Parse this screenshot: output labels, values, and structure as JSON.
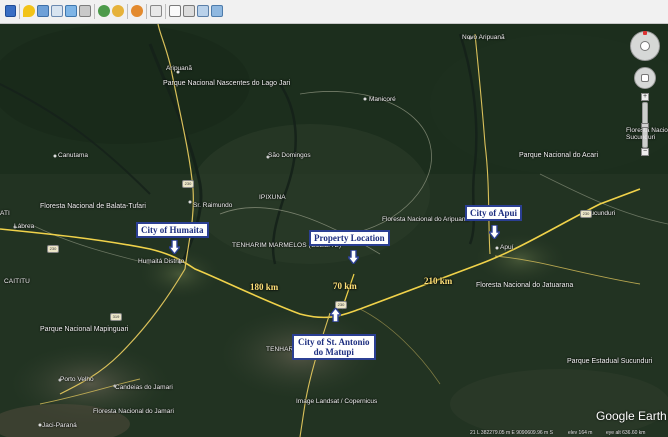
{
  "toolbar": {
    "icons": [
      "sidebar-toggle-icon",
      "placemark-icon",
      "polygon-icon",
      "path-icon",
      "image-overlay-icon",
      "tour-icon",
      "historical-imagery-icon",
      "sunlight-icon",
      "planets-icon",
      "ruler-icon",
      "email-icon",
      "print-icon",
      "save-image-icon",
      "maps-icon",
      "kml-icon"
    ]
  },
  "labels": {
    "novo_aripuana": "Novo Aripuanã",
    "aripuana_river": "Aripuanã",
    "parque_lago_jari": "Parque Nacional Nascentes do Lago Jari",
    "manicore": "Manicoré",
    "sao_domingos": "São Domingos",
    "canutama": "Canutama",
    "parque_acari": "Parque Nacional do Acari",
    "balata_tufari": "Floresta Nacional de Balata-Tufari",
    "sao_raimundo": "Sr. Raimundo",
    "ipixuna": "IPIXUNA",
    "tenharim_marmelos": "TENHARIM MARMELOS (GLEBA B)",
    "floresta_aripuana": "Floresta Nacional do Aripuanã",
    "sucunduri": "Sucunduri",
    "lati": "ATI",
    "labrea": "Lábrea",
    "humaita_town": "Humaitá Distrito",
    "apui_town": "Apuí",
    "caititu": "CAITITU",
    "jatuarana": "Floresta Nacional do Jatuarana",
    "tenharim": "TENHARI",
    "floresta_sucunduri": "Floresta Nacional do\nSucunduri",
    "mapinguari": "Parque Nacional Mapinguari",
    "porto_velho": "Porto Velho",
    "candeias": "Candeias do Jamari",
    "parque_sucunduri": "Parque Estadual Sucunduri",
    "jamari": "Floresta Nacional do Jamari",
    "jaci_parana": "Jaci-Paraná",
    "image_credit": "Image Landsat / Copernicus"
  },
  "shields": {
    "s1": "230",
    "s2": "230",
    "s3": "319",
    "s4": "230",
    "s5": "230"
  },
  "callouts": {
    "humaita": "City of Humaita",
    "property": "Property Location",
    "apui": "City of Apui",
    "matupi_line1": "City of St. Antonio",
    "matupi_line2": "do Matupi"
  },
  "distances": {
    "d1": "180 km",
    "d2": "70 km",
    "d3": "210 km"
  },
  "branding": {
    "logo": "Google Earth"
  },
  "status": {
    "coords": "21 L 382279.05 m E 9090609.96 m S",
    "elev": "elev   164 m",
    "eye": "eye alt  636.60 km"
  },
  "colors": {
    "callout_border": "#2b3f93",
    "callout_text": "#1e2f80",
    "distance_text": "#ffe27a",
    "road_main": "#f0d24a"
  }
}
